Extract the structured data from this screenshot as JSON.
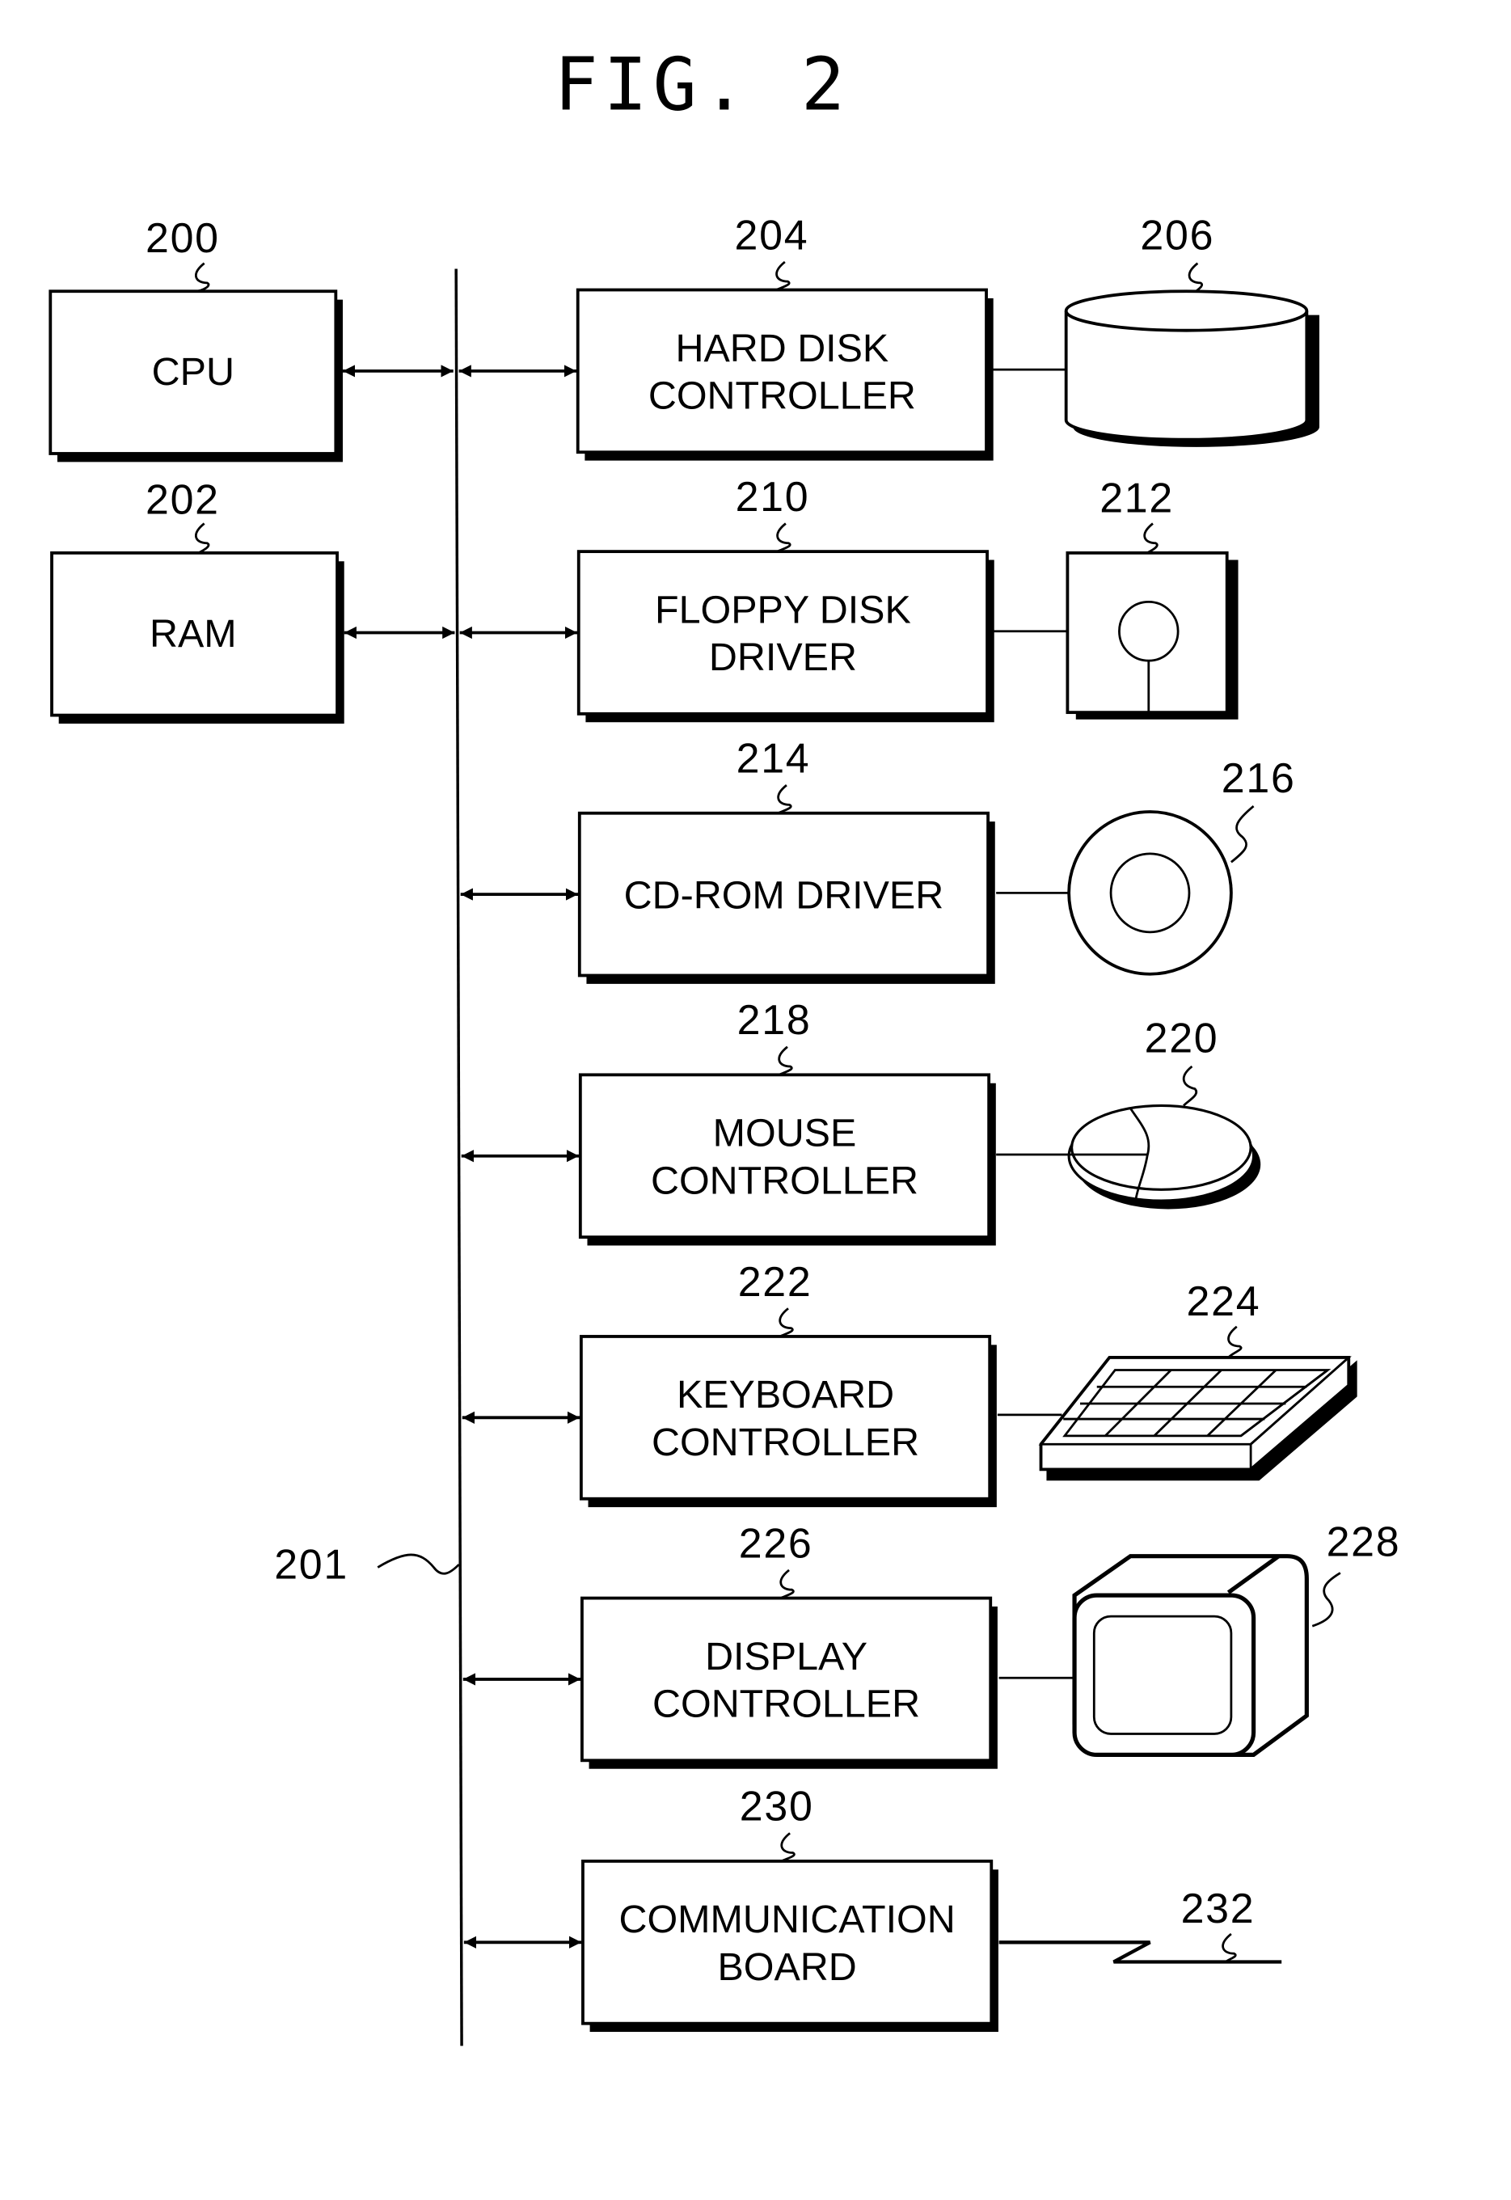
{
  "figure": {
    "title": "FIG. 2"
  },
  "bus": {
    "ref": "201"
  },
  "left_blocks": [
    {
      "ref": "200",
      "lines": [
        "CPU"
      ]
    },
    {
      "ref": "202",
      "lines": [
        "RAM"
      ]
    }
  ],
  "controllers": [
    {
      "ref": "204",
      "lines": [
        "HARD DISK",
        "CONTROLLER"
      ],
      "device_ref": "206",
      "device": "hard-disk"
    },
    {
      "ref": "210",
      "lines": [
        "FLOPPY DISK",
        "DRIVER"
      ],
      "device_ref": "212",
      "device": "floppy-disk"
    },
    {
      "ref": "214",
      "lines": [
        "CD-ROM DRIVER"
      ],
      "device_ref": "216",
      "device": "cd-rom"
    },
    {
      "ref": "218",
      "lines": [
        "MOUSE",
        "CONTROLLER"
      ],
      "device_ref": "220",
      "device": "mouse"
    },
    {
      "ref": "222",
      "lines": [
        "KEYBOARD",
        "CONTROLLER"
      ],
      "device_ref": "224",
      "device": "keyboard"
    },
    {
      "ref": "226",
      "lines": [
        "DISPLAY",
        "CONTROLLER"
      ],
      "device_ref": "228",
      "device": "display"
    },
    {
      "ref": "230",
      "lines": [
        "COMMUNICATION",
        "BOARD"
      ],
      "device_ref": "232",
      "device": "communication-line"
    }
  ]
}
